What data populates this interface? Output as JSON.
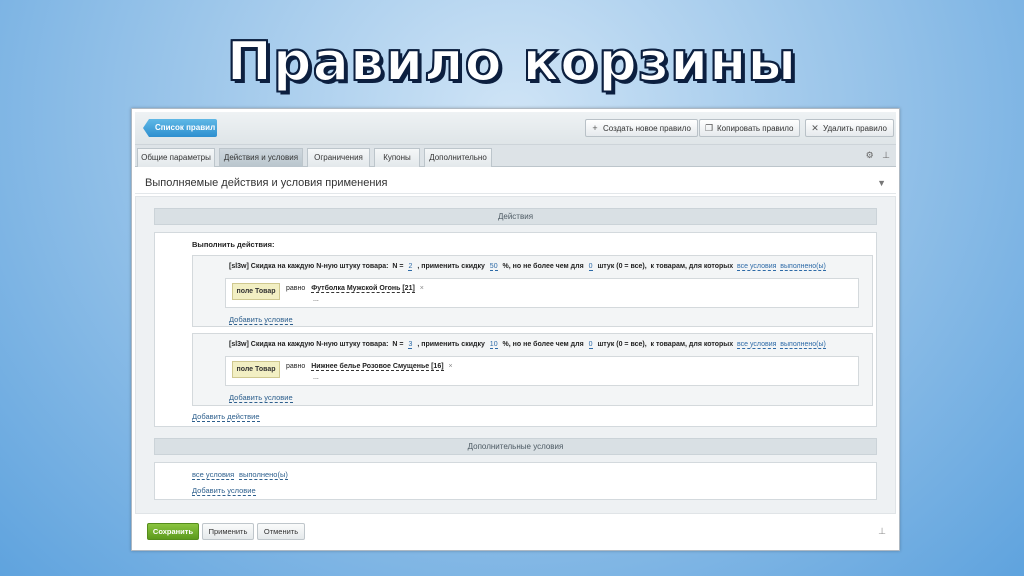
{
  "slide_title": "Правило корзины",
  "toolbar": {
    "back_label": "Список правил",
    "new_rule_label": "Создать новое правило",
    "copy_rule_label": "Копировать правило",
    "delete_rule_label": "Удалить правило"
  },
  "tabs": [
    {
      "label": "Общие параметры",
      "active": false
    },
    {
      "label": "Действия и условия",
      "active": true
    },
    {
      "label": "Ограничения",
      "active": false
    },
    {
      "label": "Купоны",
      "active": false
    },
    {
      "label": "Дополнительно",
      "active": false
    }
  ],
  "section_title": "Выполняемые действия и условия применения",
  "actions": {
    "band_label": "Действия",
    "run_label": "Выполнить действия:",
    "add_action_label": "Добавить действие",
    "rules": [
      {
        "prefix": "[sl3w] Скидка на каждую N-ную штуку товара:",
        "n_label": "N =",
        "n_value": "2",
        "apply_text": ", применить скидку",
        "discount": "50",
        "limit_text": "%, но не более чем для",
        "limit_value": "0",
        "qty_text": "штук (0 = все),",
        "for_text": "к товарам, для которых",
        "all_conditions": "все условия",
        "fulfilled": "выполнено(ы)",
        "field_label": "поле Товар",
        "equals_label": "равно",
        "product": "Футболка Мужской Огонь [21]",
        "remove_icon": "×",
        "ellipsis": "...",
        "add_condition_label": "Добавить условие"
      },
      {
        "prefix": "[sl3w] Скидка на каждую N-ную штуку товара:",
        "n_label": "N =",
        "n_value": "3",
        "apply_text": ", применить скидку",
        "discount": "10",
        "limit_text": "%, но не более чем для",
        "limit_value": "0",
        "qty_text": "штук (0 = все),",
        "for_text": "к товарам, для которых",
        "all_conditions": "все условия",
        "fulfilled": "выполнено(ы)",
        "field_label": "поле Товар",
        "equals_label": "равно",
        "product": "Нижнее белье Розовое Смущенье [16]",
        "remove_icon": "×",
        "ellipsis": "...",
        "add_condition_label": "Добавить условие"
      }
    ]
  },
  "extra_conditions": {
    "band_label": "Дополнительные условия",
    "all_conditions": "все условия",
    "fulfilled": "выполнено(ы)",
    "add_condition_label": "Добавить условие"
  },
  "footer": {
    "save_label": "Сохранить",
    "apply_label": "Применить",
    "cancel_label": "Отменить"
  },
  "icons": {
    "plus": "+",
    "copy": "❐",
    "delete": "✕",
    "gear": "⚙",
    "pin": "⊥",
    "chevron": "▼"
  },
  "colors": {
    "accent_blue": "#2e8fcf",
    "save_green": "#6aa826",
    "link": "#2d6aa7"
  }
}
